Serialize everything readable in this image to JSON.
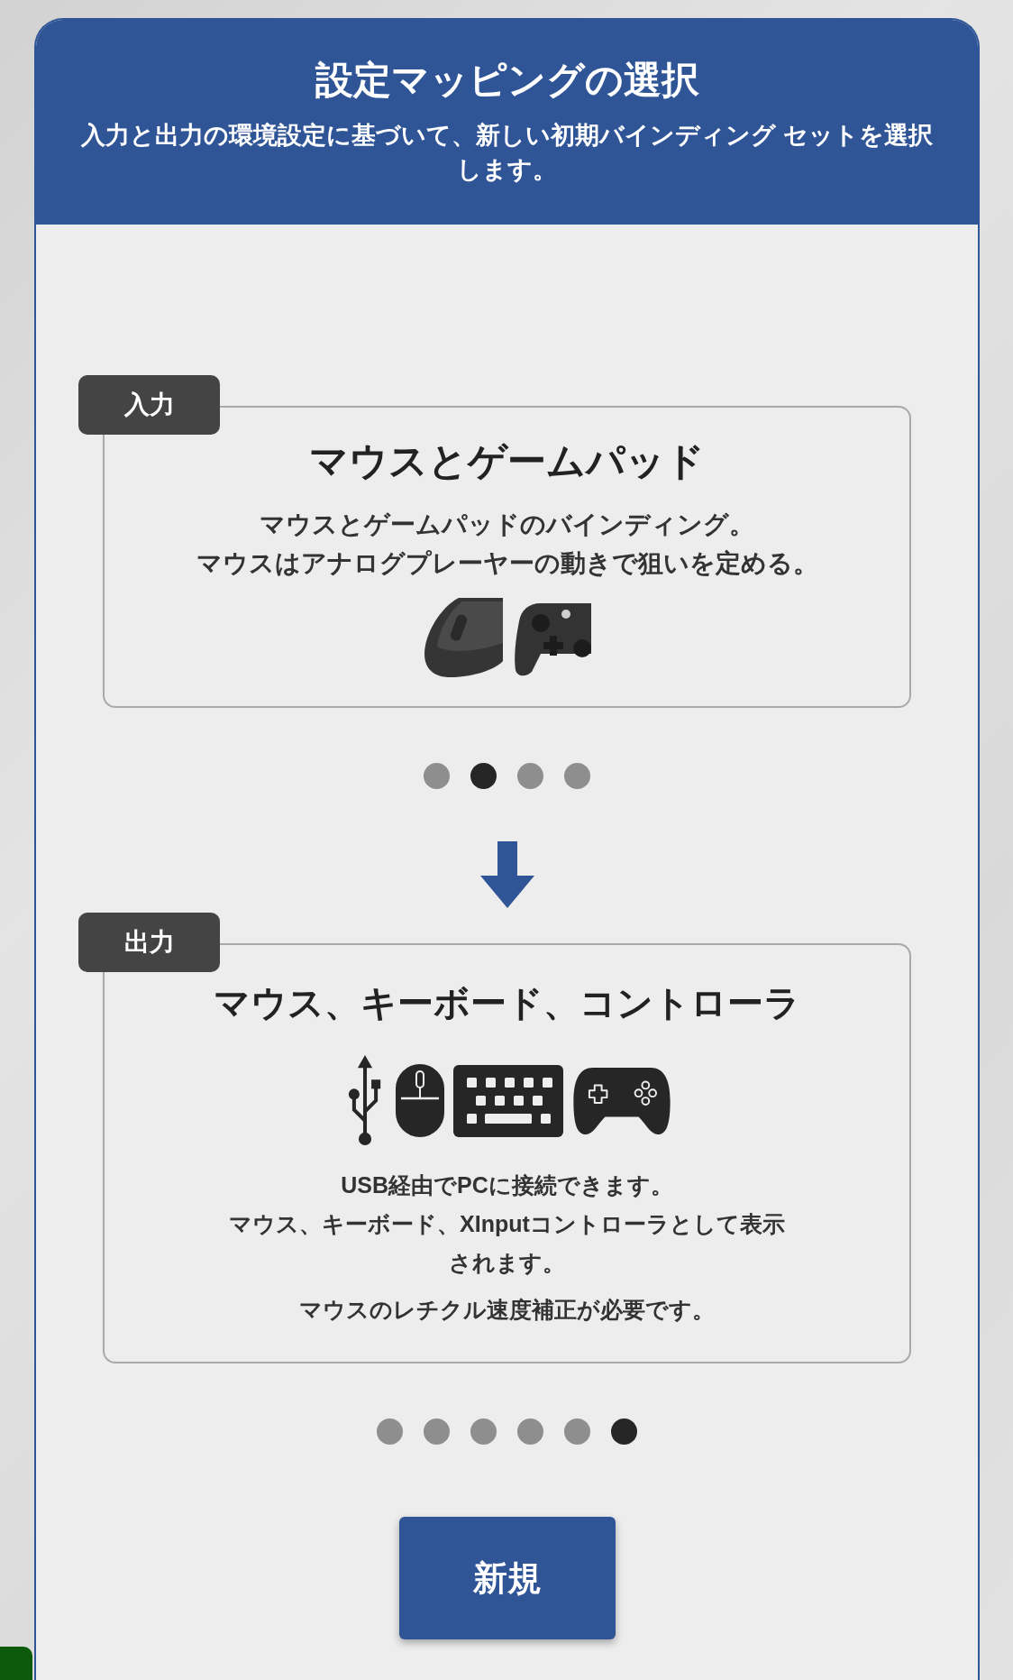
{
  "dialog": {
    "title": "設定マッピングの選択",
    "subtitle": "入力と出力の環境設定に基づいて、新しい初期バインディング セットを選択します。"
  },
  "sections": [
    {
      "kind": "input",
      "tag": "入力",
      "title": "マウスとゲームパッド",
      "description": [
        "マウスとゲームパッドのバインディング。",
        "マウスはアナログプレーヤーの動きで狙いを定める。"
      ],
      "pager": [
        {
          "selected": false
        },
        {
          "selected": true
        },
        {
          "selected": false
        },
        {
          "selected": false
        }
      ]
    },
    {
      "kind": "output",
      "tag": "出力",
      "title": "マウス、キーボード、コントローラ",
      "description": [
        "USB経由でPCに接続できます。",
        "マウス、キーボード、XInputコントローラとして表示されます。",
        "マウスのレチクル速度補正が必要です。"
      ],
      "pager": [
        {
          "selected": false
        },
        {
          "selected": false
        },
        {
          "selected": false
        },
        {
          "selected": false
        },
        {
          "selected": false
        },
        {
          "selected": true
        }
      ]
    }
  ],
  "button": {
    "label": "新規"
  }
}
